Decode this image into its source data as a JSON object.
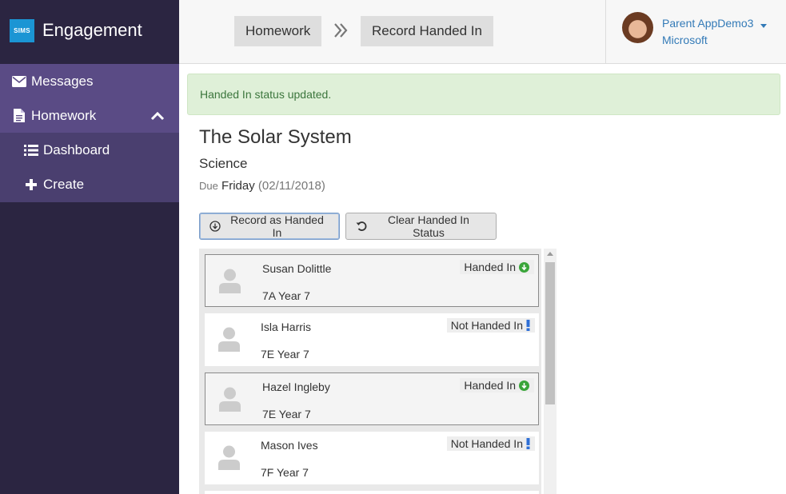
{
  "app": {
    "logo_text": "SIMS",
    "name": "Engagement"
  },
  "sidebar": {
    "items": [
      {
        "label": "Messages",
        "icon": "envelope-icon"
      },
      {
        "label": "Homework",
        "icon": "document-icon",
        "expanded": true
      },
      {
        "label": "Dashboard",
        "icon": "list-icon"
      },
      {
        "label": "Create",
        "icon": "plus-icon"
      }
    ]
  },
  "breadcrumb": {
    "items": [
      "Homework",
      "Record Handed In"
    ]
  },
  "user": {
    "name": "Parent AppDemo3",
    "org": "Microsoft"
  },
  "alert": {
    "text": "Handed In status updated."
  },
  "homework": {
    "title": "The Solar System",
    "subject": "Science",
    "due_label": "Due",
    "due_day": "Friday",
    "due_date": "(02/11/2018)"
  },
  "actions": {
    "record": "Record as Handed In",
    "clear": "Clear Handed In Status"
  },
  "students": [
    {
      "name": "Susan Dolittle",
      "group": "7A Year 7",
      "status": "Handed In",
      "selected": true
    },
    {
      "name": "Isla Harris",
      "group": "7E Year 7",
      "status": "Not Handed In",
      "selected": false
    },
    {
      "name": "Hazel Ingleby",
      "group": "7E Year 7",
      "status": "Handed In",
      "selected": true
    },
    {
      "name": "Mason Ives",
      "group": "7F Year 7",
      "status": "Not Handed In",
      "selected": false
    }
  ],
  "colors": {
    "sidebar": "#2b2541",
    "nav": "#5a4b85",
    "handed_in": "#3aa53a",
    "not_handed_in": "#2e6fd6",
    "link": "#337ab7"
  }
}
